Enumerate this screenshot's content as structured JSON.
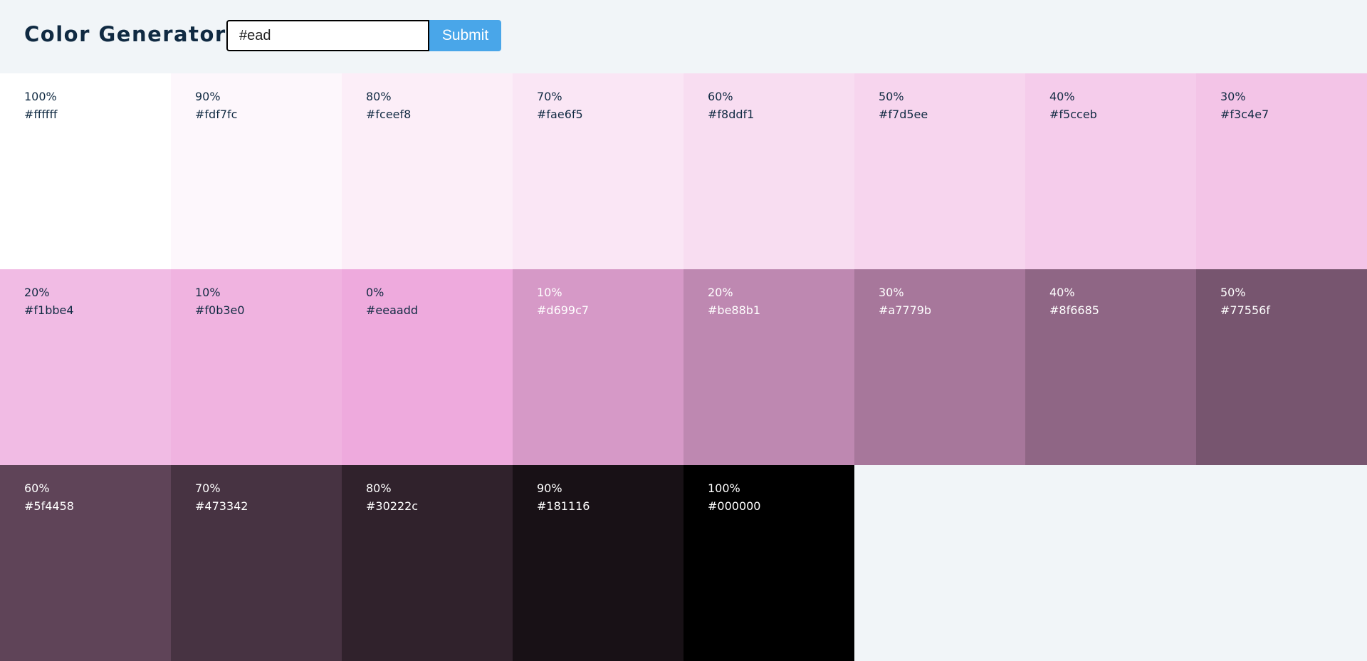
{
  "header": {
    "title": "Color Generator",
    "input_value": "#ead",
    "submit_label": "Submit"
  },
  "swatches": [
    {
      "weight": "100%",
      "hex": "#ffffff",
      "dark": false
    },
    {
      "weight": "90%",
      "hex": "#fdf7fc",
      "dark": false
    },
    {
      "weight": "80%",
      "hex": "#fceef8",
      "dark": false
    },
    {
      "weight": "70%",
      "hex": "#fae6f5",
      "dark": false
    },
    {
      "weight": "60%",
      "hex": "#f8ddf1",
      "dark": false
    },
    {
      "weight": "50%",
      "hex": "#f7d5ee",
      "dark": false
    },
    {
      "weight": "40%",
      "hex": "#f5cceb",
      "dark": false
    },
    {
      "weight": "30%",
      "hex": "#f3c4e7",
      "dark": false
    },
    {
      "weight": "20%",
      "hex": "#f1bbe4",
      "dark": false
    },
    {
      "weight": "10%",
      "hex": "#f0b3e0",
      "dark": false
    },
    {
      "weight": "0%",
      "hex": "#eeaadd",
      "dark": false
    },
    {
      "weight": "10%",
      "hex": "#d699c7",
      "dark": true
    },
    {
      "weight": "20%",
      "hex": "#be88b1",
      "dark": true
    },
    {
      "weight": "30%",
      "hex": "#a7779b",
      "dark": true
    },
    {
      "weight": "40%",
      "hex": "#8f6685",
      "dark": true
    },
    {
      "weight": "50%",
      "hex": "#77556f",
      "dark": true
    },
    {
      "weight": "60%",
      "hex": "#5f4458",
      "dark": true
    },
    {
      "weight": "70%",
      "hex": "#473342",
      "dark": true
    },
    {
      "weight": "80%",
      "hex": "#30222c",
      "dark": true
    },
    {
      "weight": "90%",
      "hex": "#181116",
      "dark": true
    },
    {
      "weight": "100%",
      "hex": "#000000",
      "dark": true
    }
  ],
  "colors": {
    "page_background": "#f1f5f8",
    "title_color": "#102a42",
    "button_background": "#49a6e9"
  }
}
